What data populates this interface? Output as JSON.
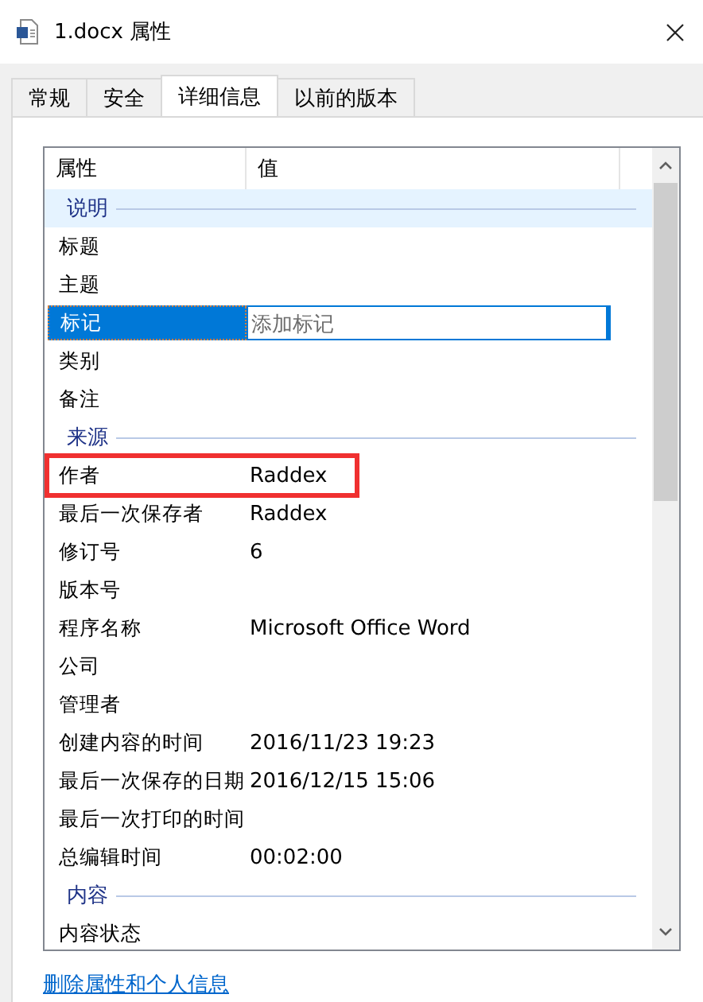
{
  "window": {
    "title": "1.docx 属性"
  },
  "tabs": [
    {
      "label": "常规",
      "selected": false
    },
    {
      "label": "安全",
      "selected": false
    },
    {
      "label": "详细信息",
      "selected": true
    },
    {
      "label": "以前的版本",
      "selected": false
    }
  ],
  "table": {
    "columns": [
      "属性",
      "值"
    ],
    "rows": [
      {
        "kind": "group",
        "label": "说明",
        "hovered": true
      },
      {
        "kind": "property",
        "name": "标题",
        "selected": false,
        "highlighted": false
      },
      {
        "kind": "property",
        "name": "主题",
        "selected": false,
        "highlighted": false
      },
      {
        "kind": "property",
        "name": "标记",
        "placeholder": "添加标记",
        "selected": true,
        "highlighted": false
      },
      {
        "kind": "property",
        "name": "类别",
        "selected": false,
        "highlighted": false
      },
      {
        "kind": "property",
        "name": "备注",
        "selected": false,
        "highlighted": false
      },
      {
        "kind": "group",
        "label": "来源",
        "hovered": false
      },
      {
        "kind": "property",
        "name": "作者",
        "value": "Raddex",
        "selected": false,
        "highlighted": true
      },
      {
        "kind": "property",
        "name": "最后一次保存者",
        "value": "Raddex",
        "selected": false,
        "highlighted": false
      },
      {
        "kind": "property",
        "name": "修订号",
        "value": "6",
        "selected": false,
        "highlighted": false
      },
      {
        "kind": "property",
        "name": "版本号",
        "selected": false,
        "highlighted": false
      },
      {
        "kind": "property",
        "name": "程序名称",
        "value": "Microsoft Office Word",
        "selected": false,
        "highlighted": false
      },
      {
        "kind": "property",
        "name": "公司",
        "selected": false,
        "highlighted": false
      },
      {
        "kind": "property",
        "name": "管理者",
        "selected": false,
        "highlighted": false
      },
      {
        "kind": "property",
        "name": "创建内容的时间",
        "value": "2016/11/23 19:23",
        "selected": false,
        "highlighted": false
      },
      {
        "kind": "property",
        "name": "最后一次保存的日期",
        "value": "2016/12/15 15:06",
        "selected": false,
        "highlighted": false
      },
      {
        "kind": "property",
        "name": "最后一次打印的时间",
        "selected": false,
        "highlighted": false
      },
      {
        "kind": "property",
        "name": "总编辑时间",
        "value": "00:02:00",
        "selected": false,
        "highlighted": false
      },
      {
        "kind": "group",
        "label": "内容",
        "hovered": false
      },
      {
        "kind": "property",
        "name": "内容状态",
        "selected": false,
        "highlighted": false
      }
    ]
  },
  "link": "删除属性和个人信息"
}
